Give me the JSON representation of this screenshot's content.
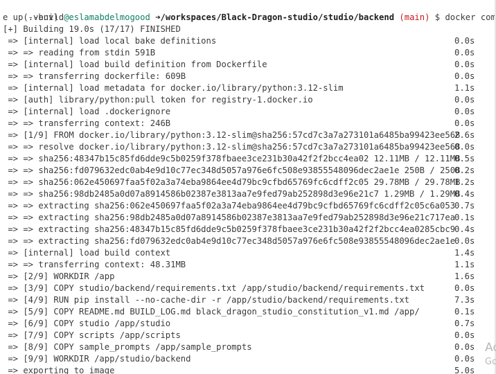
{
  "prompt": {
    "venv": "(.venv)",
    "user": "@eslamabdelmogood",
    "arrow": "➜",
    "path": "/workspaces/Black-Dragon-studio/studio/backend",
    "branch": "(main)",
    "symbol": "$",
    "command_part1": "docker compos",
    "command_part2": "e up --build"
  },
  "build_status": "[+] Building 19.0s (17/17) FINISHED",
  "lines": [
    {
      "text": " => [internal] load local bake definitions",
      "time": "0.0s"
    },
    {
      "text": " => => reading from stdin 591B",
      "time": "0.0s"
    },
    {
      "text": " => [internal] load build definition from Dockerfile",
      "time": "0.0s"
    },
    {
      "text": " => => transferring dockerfile: 609B",
      "time": "0.0s"
    },
    {
      "text": " => [internal] load metadata for docker.io/library/python:3.12-slim",
      "time": "1.1s"
    },
    {
      "text": " => [auth] library/python:pull token for registry-1.docker.io",
      "time": "0.0s"
    },
    {
      "text": " => [internal] load .dockerignore",
      "time": "0.0s"
    },
    {
      "text": " => => transferring context: 246B",
      "time": "0.0s"
    },
    {
      "text": " => [1/9] FROM docker.io/library/python:3.12-slim@sha256:57cd7c3a7a273101a6485ba99423ee568",
      "time": "2.6s"
    },
    {
      "text": " => => resolve docker.io/library/python:3.12-slim@sha256:57cd7c3a7a273101a6485ba99423ee568",
      "time": "0.0s"
    },
    {
      "text": " => => sha256:48347b15c85fd6dde9c5b0259f378fbaee3ce231b30a42f2f2bcc4ea02 12.11MB / 12.11MB",
      "time": "0.5s"
    },
    {
      "text": " => => sha256:fd079632edc0ab4e9d10c77ec348d5057a976e6fc508e93855548096dec2ae1e 250B / 250B",
      "time": "0.2s"
    },
    {
      "text": " => => sha256:062e450697faa5f02a3a74eba9864ee4d79bc9cfbd65769fc6cdff2c05 29.78MB / 29.78MB",
      "time": "1.2s"
    },
    {
      "text": " => => sha256:98db2485a0d07a8914586b02387e3813aa7e9fed79ab252898d3e96e21c7 1.29MB / 1.29MB",
      "time": "0.4s"
    },
    {
      "text": " => => extracting sha256:062e450697faa5f02a3a74eba9864ee4d79bc9cfbd65769fc6cdff2c05c6a053",
      "time": "0.7s"
    },
    {
      "text": " => => extracting sha256:98db2485a0d07a8914586b02387e3813aa7e9fed79ab252898d3e96e21c717ea",
      "time": "0.1s"
    },
    {
      "text": " => => extracting sha256:48347b15c85fd6dde9c5b0259f378fbaee3ce231b30a42f2f2bcc4ea0285cbc9",
      "time": "0.4s"
    },
    {
      "text": " => => extracting sha256:fd079632edc0ab4e9d10c77ec348d5057a976e6fc508e93855548096dec2ae1e",
      "time": "0.0s"
    },
    {
      "text": " => [internal] load build context",
      "time": "1.4s"
    },
    {
      "text": " => => transferring context: 48.31MB",
      "time": "1.1s"
    },
    {
      "text": " => [2/9] WORKDIR /app",
      "time": "1.6s"
    },
    {
      "text": " => [3/9] COPY studio/backend/requirements.txt /app/studio/backend/requirements.txt",
      "time": "0.0s"
    },
    {
      "text": " => [4/9] RUN pip install --no-cache-dir -r /app/studio/backend/requirements.txt",
      "time": "7.3s"
    },
    {
      "text": " => [5/9] COPY README.md BUILD_LOG.md black_dragon_studio_constitution_v1.md /app/",
      "time": "0.1s"
    },
    {
      "text": " => [6/9] COPY studio /app/studio",
      "time": "0.7s"
    },
    {
      "text": " => [7/9] COPY scripts /app/scripts",
      "time": "0.0s"
    },
    {
      "text": " => [8/9] COPY sample_prompts /app/sample_prompts",
      "time": "0.0s"
    },
    {
      "text": " => [9/9] WORKDIR /app/studio/backend",
      "time": "0.0s"
    },
    {
      "text": " => exporting to image",
      "time": "5.0s"
    }
  ],
  "overlay": {
    "line1": "Ac",
    "line2": "Go"
  }
}
